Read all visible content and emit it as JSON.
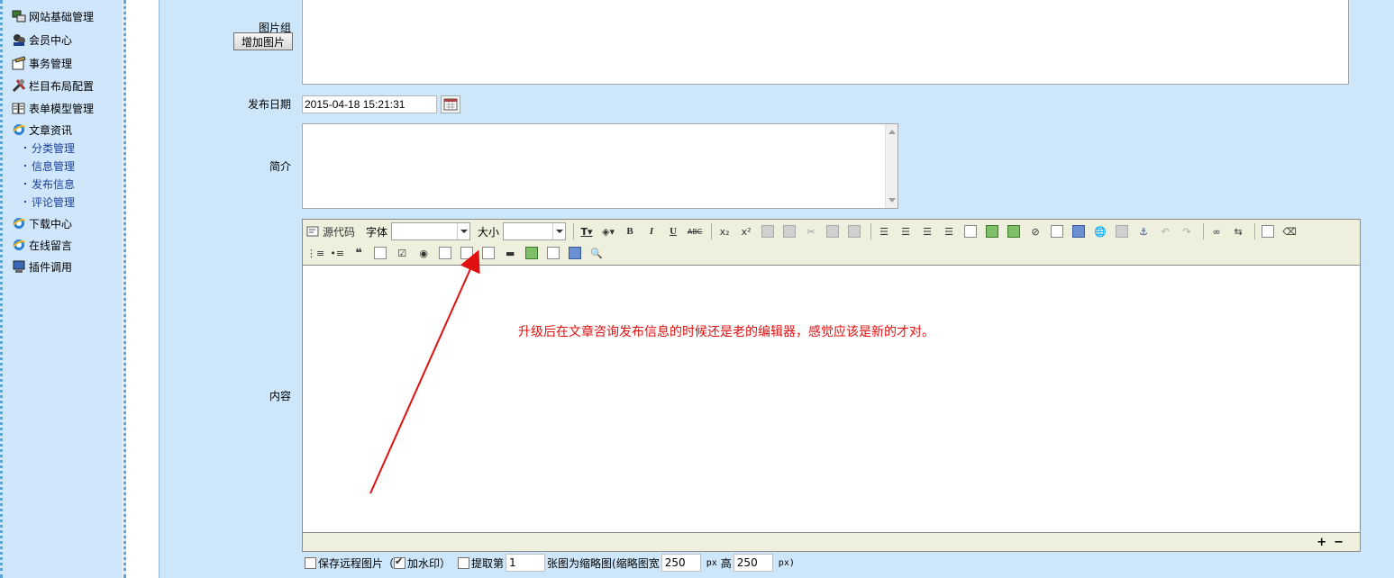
{
  "sidebar": {
    "items": [
      {
        "label": "网站基础管理",
        "icon": "computer-icon"
      },
      {
        "label": "会员中心",
        "icon": "users-icon"
      },
      {
        "label": "事务管理",
        "icon": "task-icon"
      },
      {
        "label": "栏目布局配置",
        "icon": "tools-icon"
      },
      {
        "label": "表单模型管理",
        "icon": "book-icon"
      },
      {
        "label": "文章资讯",
        "icon": "ie-icon"
      }
    ],
    "subitems": [
      "分类管理",
      "信息管理",
      "发布信息",
      "评论管理"
    ],
    "items2": [
      {
        "label": "下载中心",
        "icon": "ie-icon"
      },
      {
        "label": "在线留言",
        "icon": "ie-icon"
      },
      {
        "label": "插件调用",
        "icon": "monitor-icon"
      }
    ]
  },
  "form": {
    "image_group_label": "图片组",
    "add_image_button": "增加图片",
    "publish_date_label": "发布日期",
    "publish_date_value": "2015-04-18 15:21:31",
    "summary_label": "简介",
    "content_label": "内容"
  },
  "editor": {
    "source_label": "源代码",
    "font_label": "字体",
    "size_label": "大小",
    "resize_plus": "+",
    "resize_minus": "−"
  },
  "annotation": "升级后在文章咨询发布信息的时候还是老的编辑器，感觉应该是新的才对。",
  "options": {
    "save_remote_label": "保存远程图片（",
    "watermark_label": "加水印）",
    "extract_label": "提取第",
    "extract_index": "1",
    "thumb_label": "张图为缩略图(缩略图宽",
    "thumb_width": "250",
    "px_unit_1": "px",
    "height_label": "高",
    "thumb_height": "250",
    "px_unit_2": "px)"
  },
  "colors": {
    "sidebar_bg": "#cfe6fb",
    "main_bg": "#cde6fa",
    "toolbar_bg": "#efefde",
    "annotation": "#e01010",
    "link": "#1b3f9d"
  }
}
